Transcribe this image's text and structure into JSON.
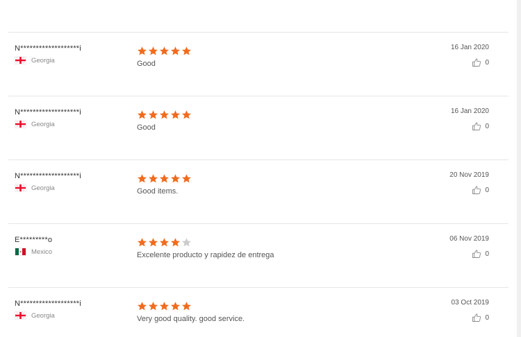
{
  "colors": {
    "star_filled": "#f26b1d",
    "star_empty": "#cccccc",
    "divider": "#e6e6e6"
  },
  "reviews": [
    {
      "user": "N*******************i",
      "country": "Georgia",
      "flag": "georgia-flag-icon",
      "rating": 5,
      "text": "Good",
      "date": "16 Jan 2020",
      "helpful": "0"
    },
    {
      "user": "N*******************i",
      "country": "Georgia",
      "flag": "georgia-flag-icon",
      "rating": 5,
      "text": "Good",
      "date": "16 Jan 2020",
      "helpful": "0"
    },
    {
      "user": "N*******************i",
      "country": "Georgia",
      "flag": "georgia-flag-icon",
      "rating": 5,
      "text": "Good items.",
      "date": "20 Nov 2019",
      "helpful": "0"
    },
    {
      "user": "E*********o",
      "country": "Mexico",
      "flag": "mexico-flag-icon",
      "rating": 4,
      "text": "Excelente producto y rapidez de entrega",
      "date": "06 Nov 2019",
      "helpful": "0"
    },
    {
      "user": "N*******************i",
      "country": "Georgia",
      "flag": "georgia-flag-icon",
      "rating": 5,
      "text": "Very good quality. good service.",
      "date": "03 Oct 2019",
      "helpful": "0"
    }
  ]
}
